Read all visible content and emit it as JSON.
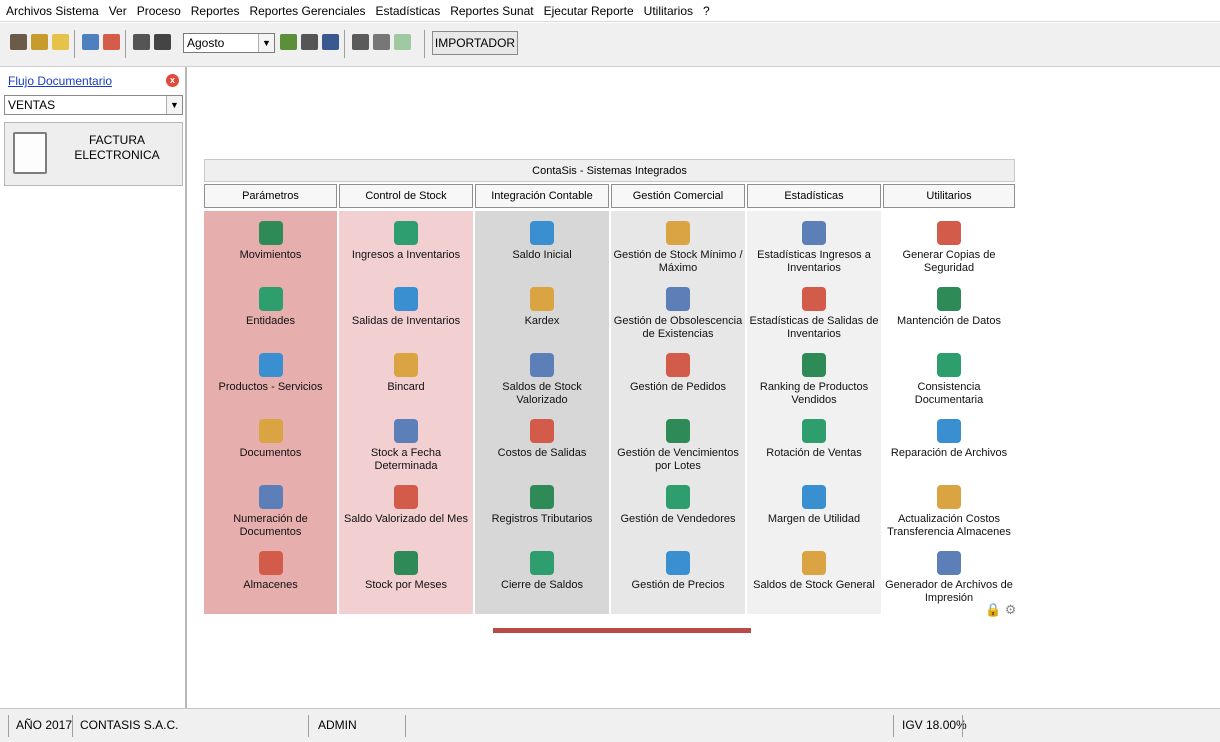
{
  "menu": [
    "Archivos Sistema",
    "Ver",
    "Proceso",
    "Reportes",
    "Reportes Gerenciales",
    "Estadísticas",
    "Reportes Sunat",
    "Ejecutar Reporte",
    "Utilitarios",
    "?"
  ],
  "toolbar": {
    "month": "Agosto",
    "importador": "IMPORTADOR"
  },
  "left": {
    "flujo": "Flujo Documentario",
    "close_glyph": "x",
    "ventas": "VENTAS",
    "factura_l1": "FACTURA",
    "factura_l2": "ELECTRONICA"
  },
  "panel": {
    "title": "ContaSis - Sistemas Integrados",
    "tabs": [
      "Parámetros",
      "Control de Stock",
      "Integración Contable",
      "Gestión Comercial",
      "Estadísticas",
      "Utilitarios"
    ],
    "columns": [
      {
        "bg": "#e7aeae",
        "items": [
          "Movimientos",
          "Entidades",
          "Productos - Servicios",
          "Documentos",
          "Numeración de Documentos",
          "Almacenes"
        ]
      },
      {
        "bg": "#f2cfd0",
        "items": [
          "Ingresos a Inventarios",
          "Salidas de Inventarios",
          "Bincard",
          "Stock a Fecha Determinada",
          "Saldo Valorizado del Mes",
          "Stock por Meses"
        ]
      },
      {
        "bg": "#d7d7d7",
        "items": [
          "Saldo Inicial",
          "Kardex",
          "Saldos de Stock Valorizado",
          "Costos de Salidas",
          "Registros Tributarios",
          "Cierre de Saldos"
        ]
      },
      {
        "bg": "#e7e7e7",
        "items": [
          "Gestión de Stock Mínimo / Máximo",
          "Gestión de Obsolescencia de Existencias",
          "Gestión de Pedidos",
          "Gestión de Vencimientos por Lotes",
          "Gestión de Vendedores",
          "Gestión de Precios"
        ]
      },
      {
        "bg": "#f1f1f1",
        "items": [
          "Estadísticas Ingresos a Inventarios",
          "Estadísticas de Salidas de Inventarios",
          "Ranking de Productos Vendidos",
          "Rotación de Ventas",
          "Margen de Utilidad",
          "Saldos de Stock General"
        ]
      },
      {
        "bg": "#ffffff",
        "items": [
          "Generar Copias de Seguridad",
          "Mantención de Datos",
          "Consistencia Documentaria",
          "Reparación de Archivos",
          "Actualización Costos Transferencia Almacenes",
          "Generador de Archivos de Impresión"
        ]
      }
    ]
  },
  "status": {
    "year": "AÑO 2017",
    "company": "CONTASIS S.A.C.",
    "user": "ADMIN",
    "igv": "IGV 18.00%"
  },
  "colors": {
    "loading": "#b94a48",
    "link": "#1a3cc0"
  }
}
